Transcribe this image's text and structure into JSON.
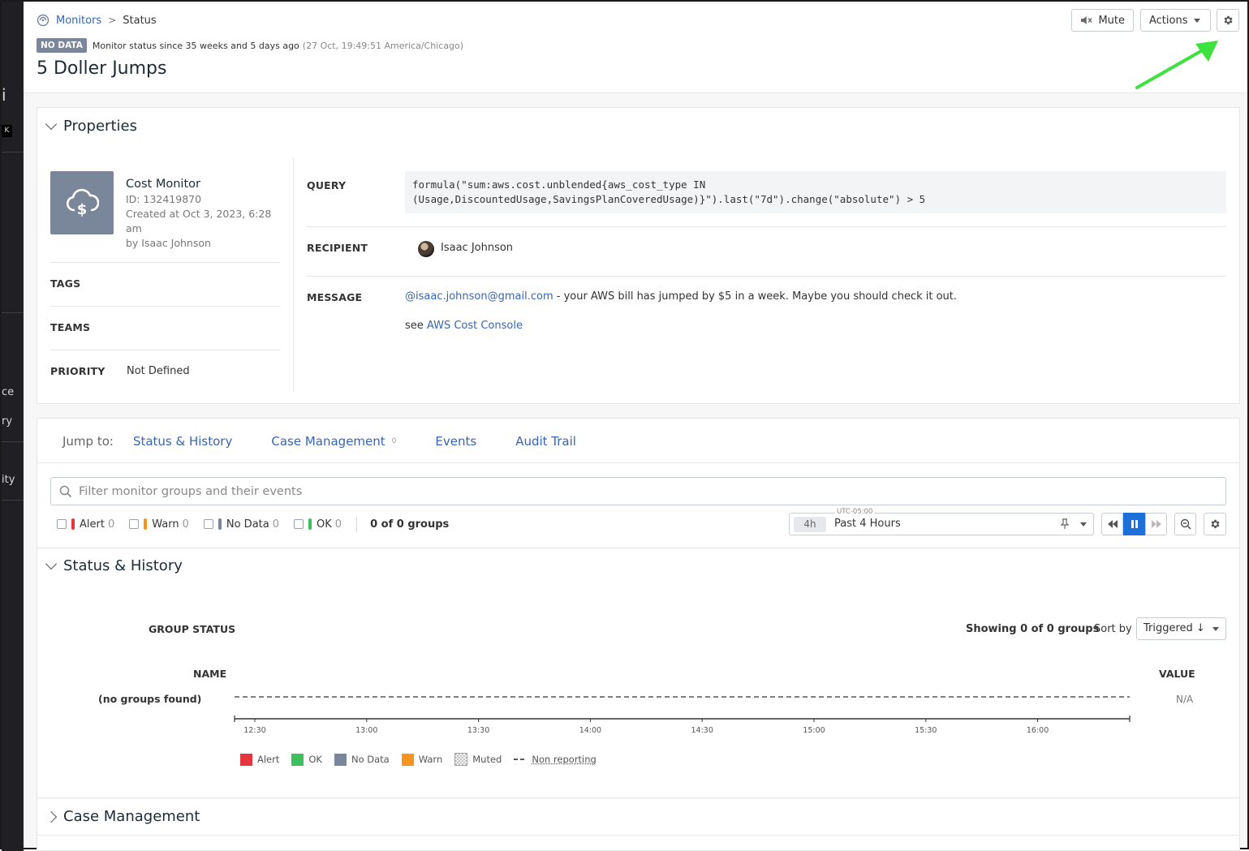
{
  "sidebar_fragments": [
    "i",
    "K",
    "ce",
    "ry",
    "ity"
  ],
  "breadcrumb": {
    "root": "Monitors",
    "current": "Status"
  },
  "status": {
    "badge": "NO DATA",
    "since": "Monitor status since 35 weeks and 5 days ago",
    "timestamp": "(27 Oct, 19:49:51 America/Chicago)"
  },
  "title": "5 Doller Jumps",
  "toolbar": {
    "mute": "Mute",
    "actions": "Actions"
  },
  "properties": {
    "heading": "Properties",
    "monitor_type": "Cost Monitor",
    "id": "ID: 132419870",
    "created": "Created at Oct 3, 2023, 6:28 am",
    "author": "by Isaac Johnson",
    "tags_label": "TAGS",
    "teams_label": "TEAMS",
    "priority_label": "PRIORITY",
    "priority_value": "Not Defined",
    "query_label": "QUERY",
    "query_line1": "formula(\"sum:aws.cost.unblended{aws_cost_type IN",
    "query_line2": "(Usage,DiscountedUsage,SavingsPlanCoveredUsage)}\").last(\"7d\").change(\"absolute\") > 5",
    "recipient_label": "RECIPIENT",
    "recipient": "Isaac Johnson",
    "message_label": "MESSAGE",
    "message_mention": "@isaac.johnson@gmail.com",
    "message_text": " - your AWS bill has jumped by $5 in a week. Maybe you should check it out.",
    "message_see": "see ",
    "message_link": "AWS Cost Console"
  },
  "jump": {
    "label": "Jump to:",
    "links": [
      "Status & History",
      "Case Management",
      "Events",
      "Audit Trail"
    ],
    "case_count": "0"
  },
  "filter": {
    "placeholder": "Filter monitor groups and their events"
  },
  "status_filters": [
    {
      "label": "Alert",
      "count": "0",
      "color": "#e5353f"
    },
    {
      "label": "Warn",
      "count": "0",
      "color": "#f79420"
    },
    {
      "label": "No Data",
      "count": "0",
      "color": "#7a8699"
    },
    {
      "label": "OK",
      "count": "0",
      "color": "#3ebf5d"
    }
  ],
  "groups_count": "0 of 0 groups",
  "time": {
    "tz": "UTC-05:00",
    "chip": "4h",
    "label": "Past 4 Hours"
  },
  "status_history": {
    "heading": "Status & History",
    "group_status": "GROUP STATUS",
    "showing": "Showing 0 of 0 groups",
    "sort_by": "Sort by",
    "sort_value": "Triggered ↓",
    "name_col": "NAME",
    "value_col": "VALUE",
    "no_groups": "(no groups found)",
    "na": "N/A",
    "ticks": [
      "12:30",
      "13:00",
      "13:30",
      "14:00",
      "14:30",
      "15:00",
      "15:30",
      "16:00"
    ],
    "legend": [
      {
        "label": "Alert",
        "color": "#e5353f"
      },
      {
        "label": "OK",
        "color": "#3ebf5d"
      },
      {
        "label": "No Data",
        "color": "#7a8699"
      },
      {
        "label": "Warn",
        "color": "#f79420"
      },
      {
        "label": "Muted",
        "color": "pattern"
      },
      {
        "label": "Non reporting",
        "color": "dashed"
      }
    ]
  },
  "case_management": {
    "heading": "Case Management"
  }
}
